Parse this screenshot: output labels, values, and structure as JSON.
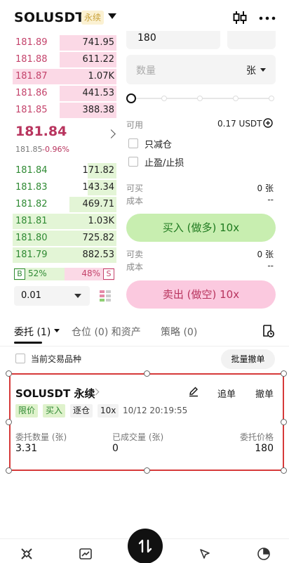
{
  "header": {
    "symbol": "SOLUSDT",
    "badge": "永续"
  },
  "orderbook": {
    "asks": [
      {
        "price": "181.89",
        "qty": "741.95",
        "depth": 0.55
      },
      {
        "price": "181.88",
        "qty": "611.22",
        "depth": 0.55
      },
      {
        "price": "181.87",
        "qty": "1.07K",
        "depth": 1.0
      },
      {
        "price": "181.86",
        "qty": "441.53",
        "depth": 0.55
      },
      {
        "price": "181.85",
        "qty": "388.38",
        "depth": 0.55
      }
    ],
    "last_price": "181.84",
    "mark_price": "181.85",
    "change": "-0.96%",
    "bids": [
      {
        "price": "181.84",
        "qty": "171.82",
        "depth": 0.28
      },
      {
        "price": "181.83",
        "qty": "143.34",
        "depth": 0.28
      },
      {
        "price": "181.82",
        "qty": "469.71",
        "depth": 0.45
      },
      {
        "price": "181.81",
        "qty": "1.03K",
        "depth": 1.0
      },
      {
        "price": "181.80",
        "qty": "725.82",
        "depth": 1.0
      },
      {
        "price": "181.79",
        "qty": "882.53",
        "depth": 1.0
      }
    ],
    "buy_ratio_label": "B",
    "buy_ratio": "52%",
    "sell_ratio": "48%",
    "sell_ratio_label": "S",
    "precision": "0.01"
  },
  "form": {
    "price_value": "180",
    "qty_placeholder": "数量",
    "qty_unit": "张",
    "available_label": "可用",
    "available_value": "0.17 USDT",
    "reduce_only": "只减仓",
    "tp_sl": "止盈/止损",
    "can_buy_label": "可买",
    "can_buy_value": "0 张",
    "cost_label": "成本",
    "cost_value": "--",
    "buy_button": "买入 (做多) 10x",
    "can_sell_label": "可卖",
    "can_sell_value": "0 张",
    "cost2_label": "成本",
    "cost2_value": "--",
    "sell_button": "卖出 (做空) 10x"
  },
  "tabs": {
    "orders": "委托 (1)",
    "positions": "仓位 (0) 和资产",
    "strategy": "策略 (0)"
  },
  "filter": {
    "current_only": "当前交易品种",
    "cancel_all": "批量撤单"
  },
  "order": {
    "symbol": "SOLUSDT 永续",
    "chase": "追单",
    "cancel": "撤单",
    "tags": [
      "限价",
      "买入",
      "逐仓",
      "10x"
    ],
    "time": "10/12 20:19:55",
    "qty_label": "委托数量 (张)",
    "qty_value": "3.31",
    "filled_label": "已成交量 (张)",
    "filled_value": "0",
    "price_label": "委托价格",
    "price_value": "180"
  }
}
